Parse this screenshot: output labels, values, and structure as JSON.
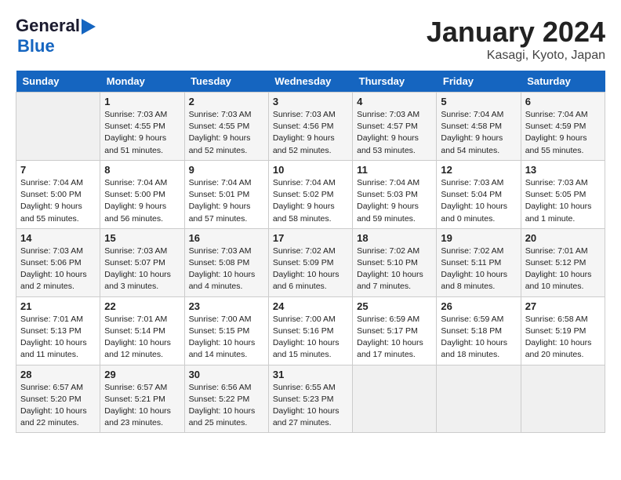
{
  "header": {
    "logo_general": "General",
    "logo_blue": "Blue",
    "title": "January 2024",
    "subtitle": "Kasagi, Kyoto, Japan"
  },
  "columns": [
    "Sunday",
    "Monday",
    "Tuesday",
    "Wednesday",
    "Thursday",
    "Friday",
    "Saturday"
  ],
  "weeks": [
    [
      {
        "num": "",
        "sunrise": "",
        "sunset": "",
        "daylight": "",
        "empty": true
      },
      {
        "num": "1",
        "sunrise": "Sunrise: 7:03 AM",
        "sunset": "Sunset: 4:55 PM",
        "daylight": "Daylight: 9 hours and 51 minutes."
      },
      {
        "num": "2",
        "sunrise": "Sunrise: 7:03 AM",
        "sunset": "Sunset: 4:55 PM",
        "daylight": "Daylight: 9 hours and 52 minutes."
      },
      {
        "num": "3",
        "sunrise": "Sunrise: 7:03 AM",
        "sunset": "Sunset: 4:56 PM",
        "daylight": "Daylight: 9 hours and 52 minutes."
      },
      {
        "num": "4",
        "sunrise": "Sunrise: 7:03 AM",
        "sunset": "Sunset: 4:57 PM",
        "daylight": "Daylight: 9 hours and 53 minutes."
      },
      {
        "num": "5",
        "sunrise": "Sunrise: 7:04 AM",
        "sunset": "Sunset: 4:58 PM",
        "daylight": "Daylight: 9 hours and 54 minutes."
      },
      {
        "num": "6",
        "sunrise": "Sunrise: 7:04 AM",
        "sunset": "Sunset: 4:59 PM",
        "daylight": "Daylight: 9 hours and 55 minutes."
      }
    ],
    [
      {
        "num": "7",
        "sunrise": "Sunrise: 7:04 AM",
        "sunset": "Sunset: 5:00 PM",
        "daylight": "Daylight: 9 hours and 55 minutes."
      },
      {
        "num": "8",
        "sunrise": "Sunrise: 7:04 AM",
        "sunset": "Sunset: 5:00 PM",
        "daylight": "Daylight: 9 hours and 56 minutes."
      },
      {
        "num": "9",
        "sunrise": "Sunrise: 7:04 AM",
        "sunset": "Sunset: 5:01 PM",
        "daylight": "Daylight: 9 hours and 57 minutes."
      },
      {
        "num": "10",
        "sunrise": "Sunrise: 7:04 AM",
        "sunset": "Sunset: 5:02 PM",
        "daylight": "Daylight: 9 hours and 58 minutes."
      },
      {
        "num": "11",
        "sunrise": "Sunrise: 7:04 AM",
        "sunset": "Sunset: 5:03 PM",
        "daylight": "Daylight: 9 hours and 59 minutes."
      },
      {
        "num": "12",
        "sunrise": "Sunrise: 7:03 AM",
        "sunset": "Sunset: 5:04 PM",
        "daylight": "Daylight: 10 hours and 0 minutes."
      },
      {
        "num": "13",
        "sunrise": "Sunrise: 7:03 AM",
        "sunset": "Sunset: 5:05 PM",
        "daylight": "Daylight: 10 hours and 1 minute."
      }
    ],
    [
      {
        "num": "14",
        "sunrise": "Sunrise: 7:03 AM",
        "sunset": "Sunset: 5:06 PM",
        "daylight": "Daylight: 10 hours and 2 minutes."
      },
      {
        "num": "15",
        "sunrise": "Sunrise: 7:03 AM",
        "sunset": "Sunset: 5:07 PM",
        "daylight": "Daylight: 10 hours and 3 minutes."
      },
      {
        "num": "16",
        "sunrise": "Sunrise: 7:03 AM",
        "sunset": "Sunset: 5:08 PM",
        "daylight": "Daylight: 10 hours and 4 minutes."
      },
      {
        "num": "17",
        "sunrise": "Sunrise: 7:02 AM",
        "sunset": "Sunset: 5:09 PM",
        "daylight": "Daylight: 10 hours and 6 minutes."
      },
      {
        "num": "18",
        "sunrise": "Sunrise: 7:02 AM",
        "sunset": "Sunset: 5:10 PM",
        "daylight": "Daylight: 10 hours and 7 minutes."
      },
      {
        "num": "19",
        "sunrise": "Sunrise: 7:02 AM",
        "sunset": "Sunset: 5:11 PM",
        "daylight": "Daylight: 10 hours and 8 minutes."
      },
      {
        "num": "20",
        "sunrise": "Sunrise: 7:01 AM",
        "sunset": "Sunset: 5:12 PM",
        "daylight": "Daylight: 10 hours and 10 minutes."
      }
    ],
    [
      {
        "num": "21",
        "sunrise": "Sunrise: 7:01 AM",
        "sunset": "Sunset: 5:13 PM",
        "daylight": "Daylight: 10 hours and 11 minutes."
      },
      {
        "num": "22",
        "sunrise": "Sunrise: 7:01 AM",
        "sunset": "Sunset: 5:14 PM",
        "daylight": "Daylight: 10 hours and 12 minutes."
      },
      {
        "num": "23",
        "sunrise": "Sunrise: 7:00 AM",
        "sunset": "Sunset: 5:15 PM",
        "daylight": "Daylight: 10 hours and 14 minutes."
      },
      {
        "num": "24",
        "sunrise": "Sunrise: 7:00 AM",
        "sunset": "Sunset: 5:16 PM",
        "daylight": "Daylight: 10 hours and 15 minutes."
      },
      {
        "num": "25",
        "sunrise": "Sunrise: 6:59 AM",
        "sunset": "Sunset: 5:17 PM",
        "daylight": "Daylight: 10 hours and 17 minutes."
      },
      {
        "num": "26",
        "sunrise": "Sunrise: 6:59 AM",
        "sunset": "Sunset: 5:18 PM",
        "daylight": "Daylight: 10 hours and 18 minutes."
      },
      {
        "num": "27",
        "sunrise": "Sunrise: 6:58 AM",
        "sunset": "Sunset: 5:19 PM",
        "daylight": "Daylight: 10 hours and 20 minutes."
      }
    ],
    [
      {
        "num": "28",
        "sunrise": "Sunrise: 6:57 AM",
        "sunset": "Sunset: 5:20 PM",
        "daylight": "Daylight: 10 hours and 22 minutes."
      },
      {
        "num": "29",
        "sunrise": "Sunrise: 6:57 AM",
        "sunset": "Sunset: 5:21 PM",
        "daylight": "Daylight: 10 hours and 23 minutes."
      },
      {
        "num": "30",
        "sunrise": "Sunrise: 6:56 AM",
        "sunset": "Sunset: 5:22 PM",
        "daylight": "Daylight: 10 hours and 25 minutes."
      },
      {
        "num": "31",
        "sunrise": "Sunrise: 6:55 AM",
        "sunset": "Sunset: 5:23 PM",
        "daylight": "Daylight: 10 hours and 27 minutes."
      },
      {
        "num": "",
        "sunrise": "",
        "sunset": "",
        "daylight": "",
        "empty": true
      },
      {
        "num": "",
        "sunrise": "",
        "sunset": "",
        "daylight": "",
        "empty": true
      },
      {
        "num": "",
        "sunrise": "",
        "sunset": "",
        "daylight": "",
        "empty": true
      }
    ]
  ]
}
